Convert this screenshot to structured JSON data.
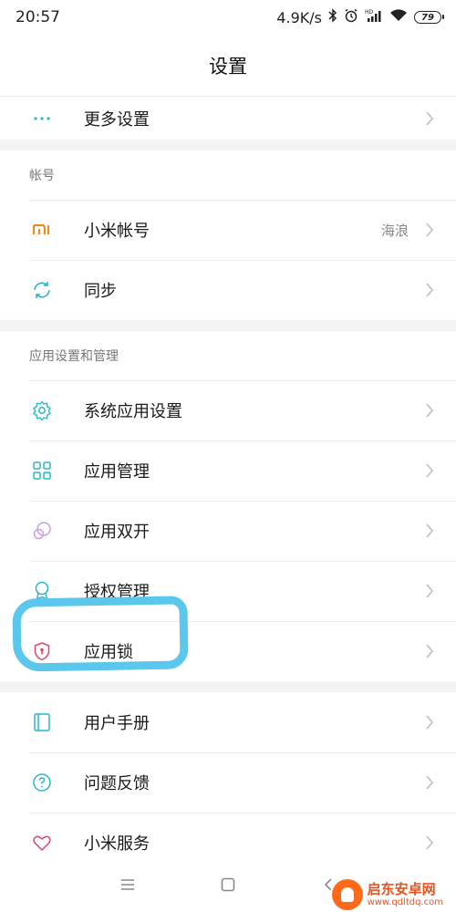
{
  "status": {
    "time": "20:57",
    "speed": "4.9K/s",
    "battery": "79"
  },
  "header": {
    "title": "设置"
  },
  "top_item": {
    "label": "更多设置"
  },
  "account_section": {
    "header": "帐号",
    "items": [
      {
        "label": "小米帐号",
        "value": "海浪",
        "icon": "mi-logo-icon"
      },
      {
        "label": "同步",
        "icon": "sync-icon"
      }
    ]
  },
  "apps_section": {
    "header": "应用设置和管理",
    "items": [
      {
        "label": "系统应用设置",
        "icon": "gear-icon"
      },
      {
        "label": "应用管理",
        "icon": "grid-icon"
      },
      {
        "label": "应用双开",
        "icon": "dual-circle-icon"
      },
      {
        "label": "授权管理",
        "icon": "badge-icon"
      },
      {
        "label": "应用锁",
        "icon": "shield-lock-icon"
      }
    ]
  },
  "support_section": {
    "items": [
      {
        "label": "用户手册",
        "icon": "book-icon"
      },
      {
        "label": "问题反馈",
        "icon": "help-icon"
      },
      {
        "label": "小米服务",
        "icon": "heart-icon"
      }
    ]
  },
  "colors": {
    "accent_teal": "#29b6c9",
    "mi_orange": "#f08a24",
    "highlight": "#5cc7ec",
    "heart_red": "#e0476a"
  },
  "watermark": {
    "title": "启东安卓网",
    "url": "www.qdltdq.com"
  }
}
